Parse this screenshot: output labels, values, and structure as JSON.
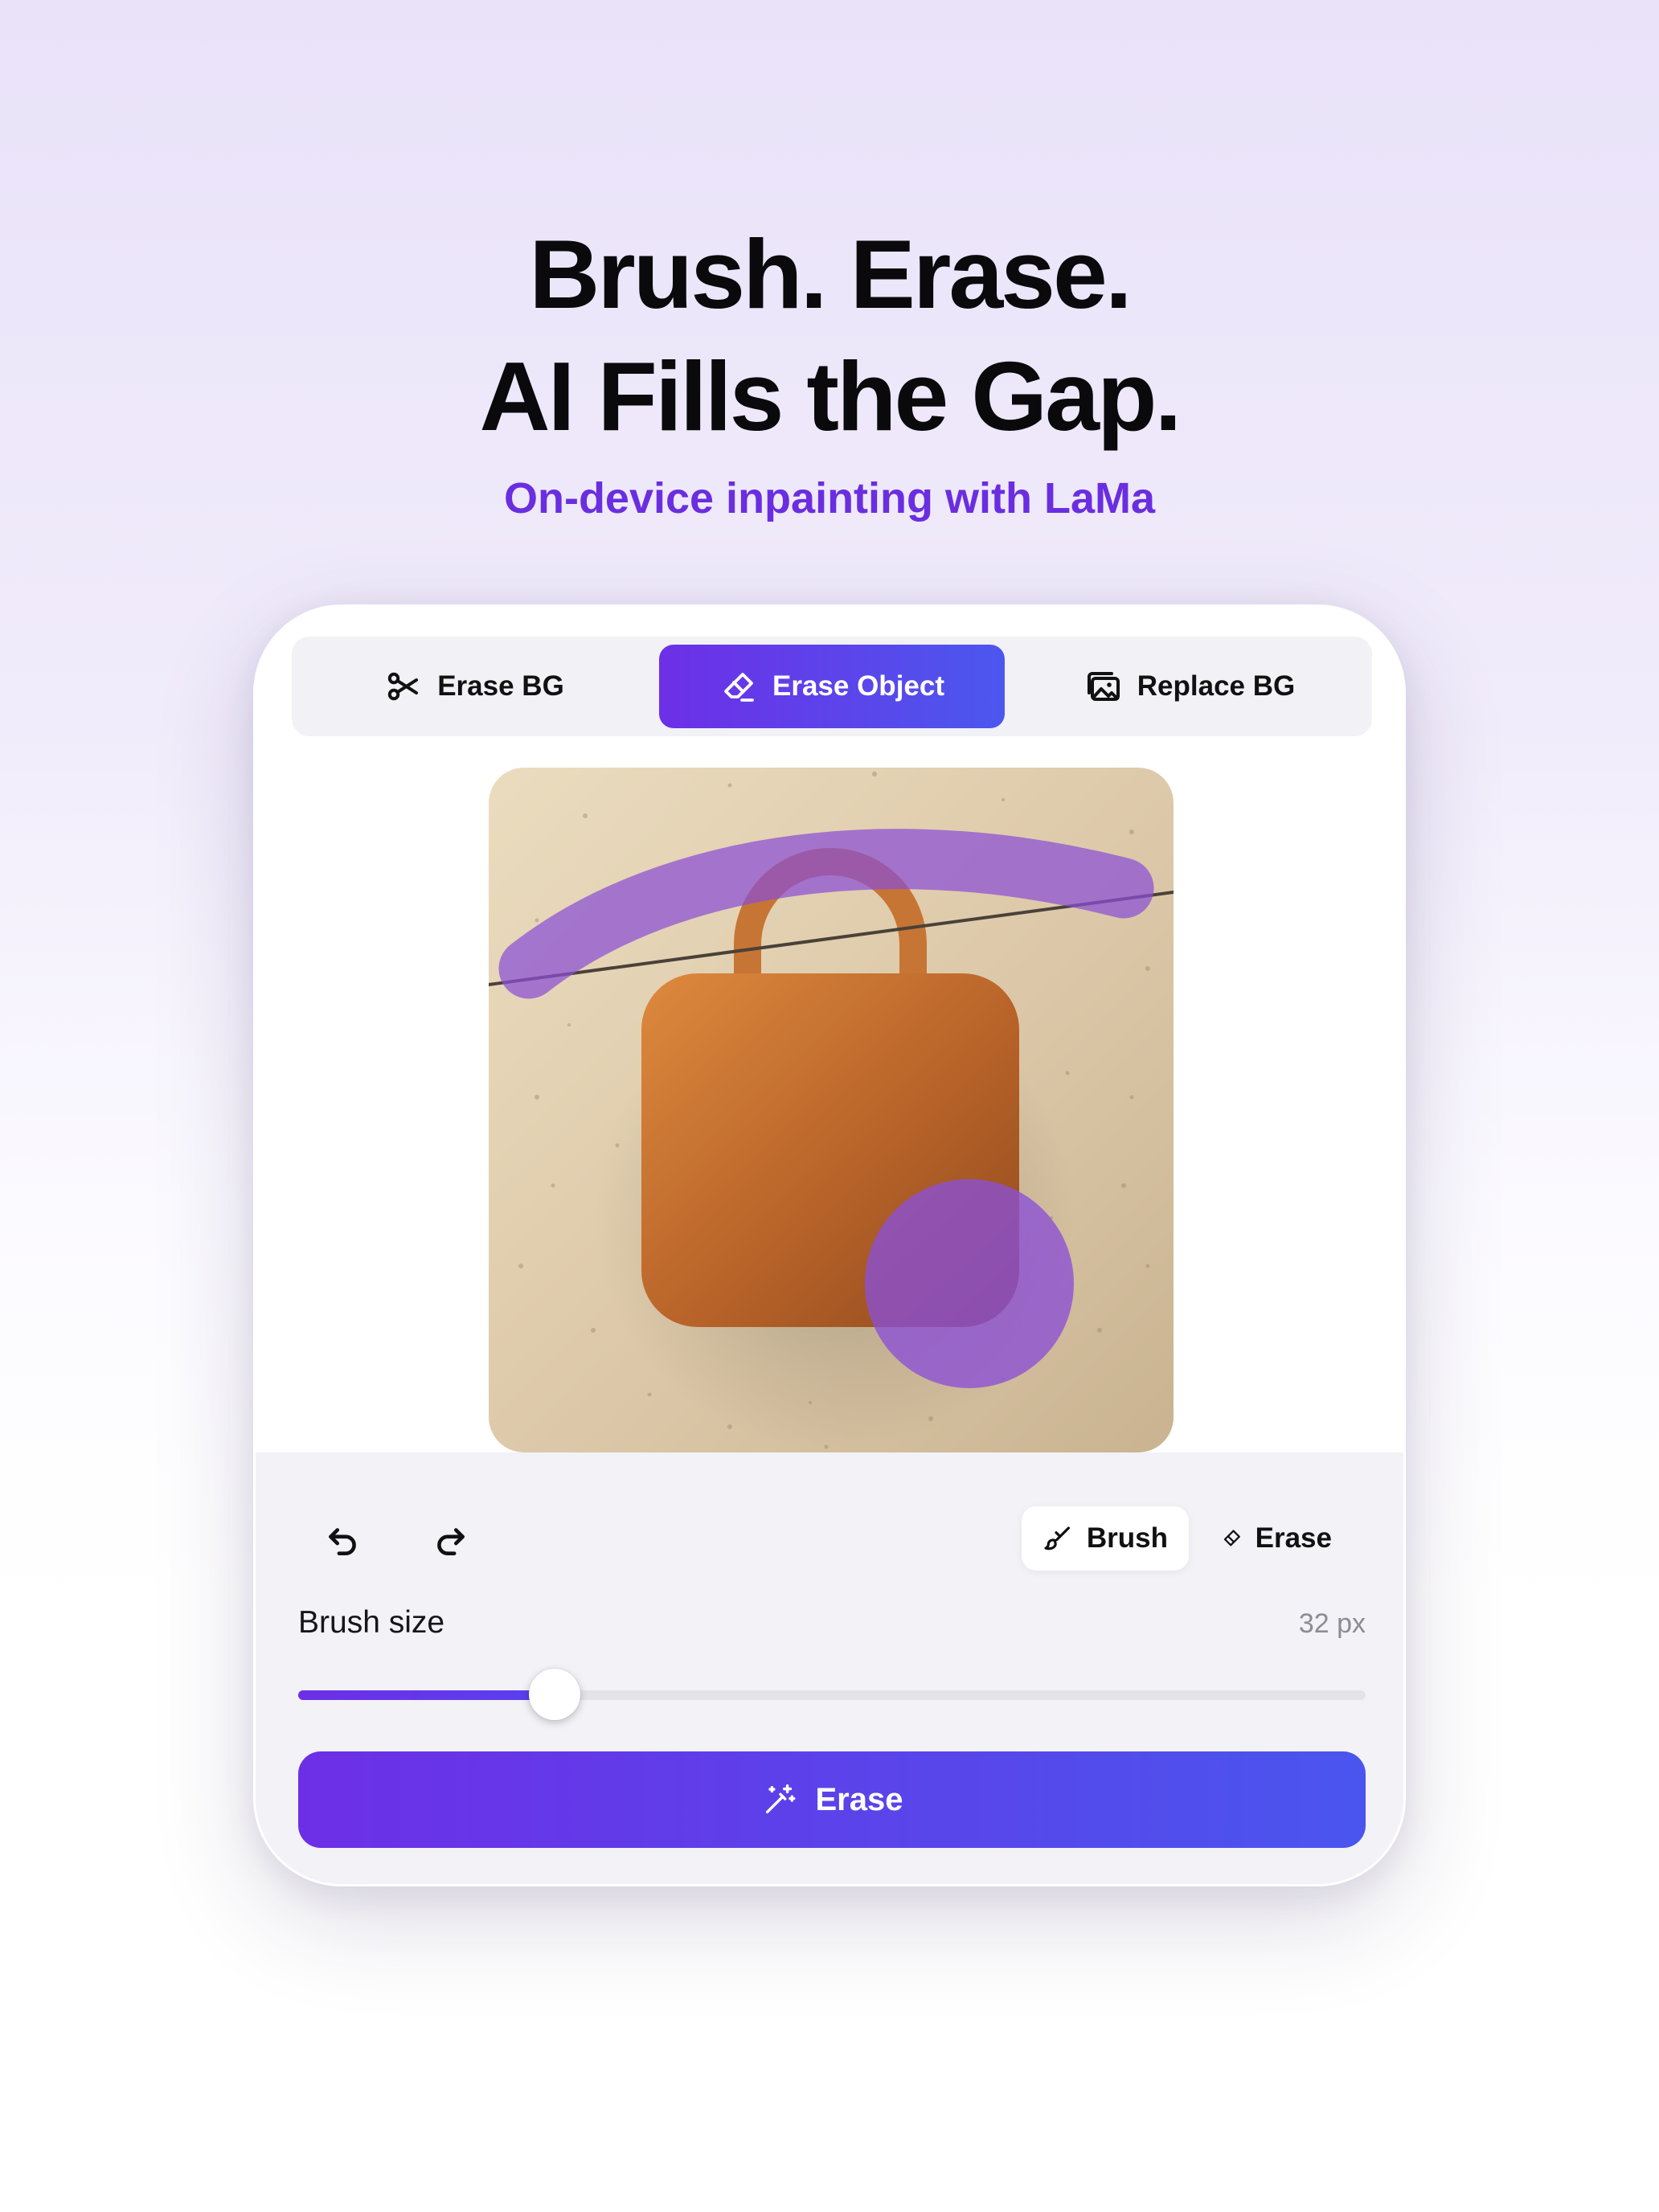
{
  "hero": {
    "title_line1": "Brush. Erase.",
    "title_line2": "AI Fills the Gap.",
    "subtitle": "On-device inpainting with LaMa"
  },
  "tabs": [
    {
      "label": "Erase BG",
      "icon": "scissors-icon",
      "active": false
    },
    {
      "label": "Erase Object",
      "icon": "eraser-icon",
      "active": true
    },
    {
      "label": "Replace BG",
      "icon": "photo-stack-icon",
      "active": false
    }
  ],
  "toolbar": {
    "undo_icon": "undo-icon",
    "redo_icon": "redo-icon",
    "modes": [
      {
        "label": "Brush",
        "icon": "brush-icon",
        "active": true
      },
      {
        "label": "Erase",
        "icon": "eraser-icon",
        "active": false
      }
    ]
  },
  "brush": {
    "label": "Brush size",
    "value_text": "32 px",
    "slider_fraction": 0.24
  },
  "action": {
    "label": "Erase",
    "icon": "magic-wand-icon"
  },
  "colors": {
    "accent_start": "#6d2fe6",
    "accent_end": "#4a55ee",
    "subtitle": "#6a2ee0",
    "mask_overlay": "#8a4fd6"
  }
}
